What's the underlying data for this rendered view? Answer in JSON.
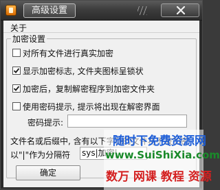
{
  "window": {
    "title": "高级设置",
    "colors": {
      "titlebar": "#3d3d3d",
      "client": "#f0f0f0",
      "checkmark": "#1a1a1a"
    }
  },
  "menu": {
    "about_label": "关于"
  },
  "group": {
    "title": "加密设置",
    "options": [
      {
        "label": "对所有文件进行真实加密",
        "checked": false
      },
      {
        "label": "显示加密标志, 文件夹图标呈锁状",
        "checked": true
      },
      {
        "label": "加密后，复制解密程序到加密文件夹",
        "checked": true
      },
      {
        "label": "使用密码提示, 提示将出现在解密界面",
        "checked": false
      }
    ],
    "hint_label": "密码提示:",
    "hint_value": "",
    "exclude_desc_line1": "文件名或后缀中, 含有以下字符的文件将不被加密",
    "exclude_desc_line2": "以\"|\"作为分隔符",
    "exclude_value": "sys|加密|"
  },
  "buttons": {
    "ok_label": "确定"
  },
  "watermark": {
    "line1": "随时下免费资源网",
    "line2": "www.SuiShiXia.com",
    "line3": "数万 网课 教程 资源"
  }
}
